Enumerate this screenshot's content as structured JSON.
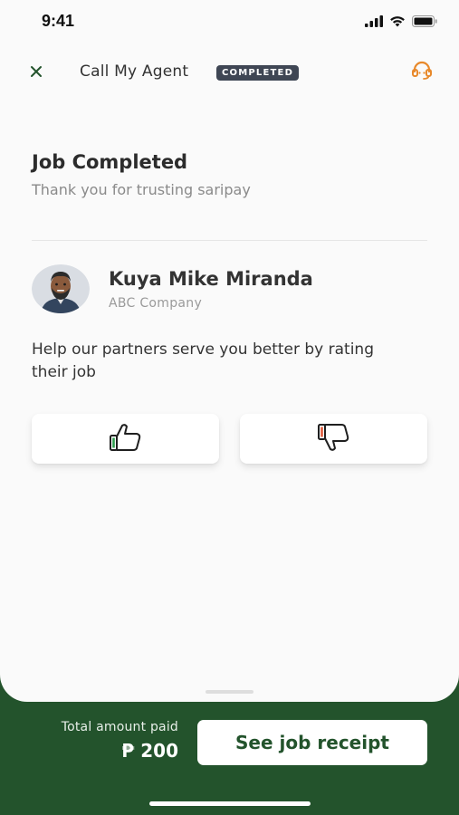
{
  "status_bar": {
    "time": "9:41",
    "icons": [
      "signal-icon",
      "wifi-icon",
      "battery-icon"
    ]
  },
  "header": {
    "close_icon": "close-icon",
    "title": "Call My Agent",
    "status": "COMPLETED",
    "support_icon": "headset-icon"
  },
  "content": {
    "title": "Job Completed",
    "subtitle": "Thank you for trusting saripay",
    "agent": {
      "name": "Kuya Mike Miranda",
      "company": "ABC Company"
    },
    "prompt": "Help our partners serve you better by rating their job",
    "rating": {
      "up_icon": "thumbs-up-icon",
      "down_icon": "thumbs-down-icon"
    }
  },
  "footer": {
    "total_label": "Total amount paid",
    "total_amount": "₱ 200",
    "receipt_button": "See job receipt"
  },
  "colors": {
    "brand_green": "#23532c",
    "badge_bg": "#3f4654",
    "support_orange": "#e8892b",
    "thumb_green": "#2e9e4e",
    "thumb_red": "#e05a3a"
  }
}
